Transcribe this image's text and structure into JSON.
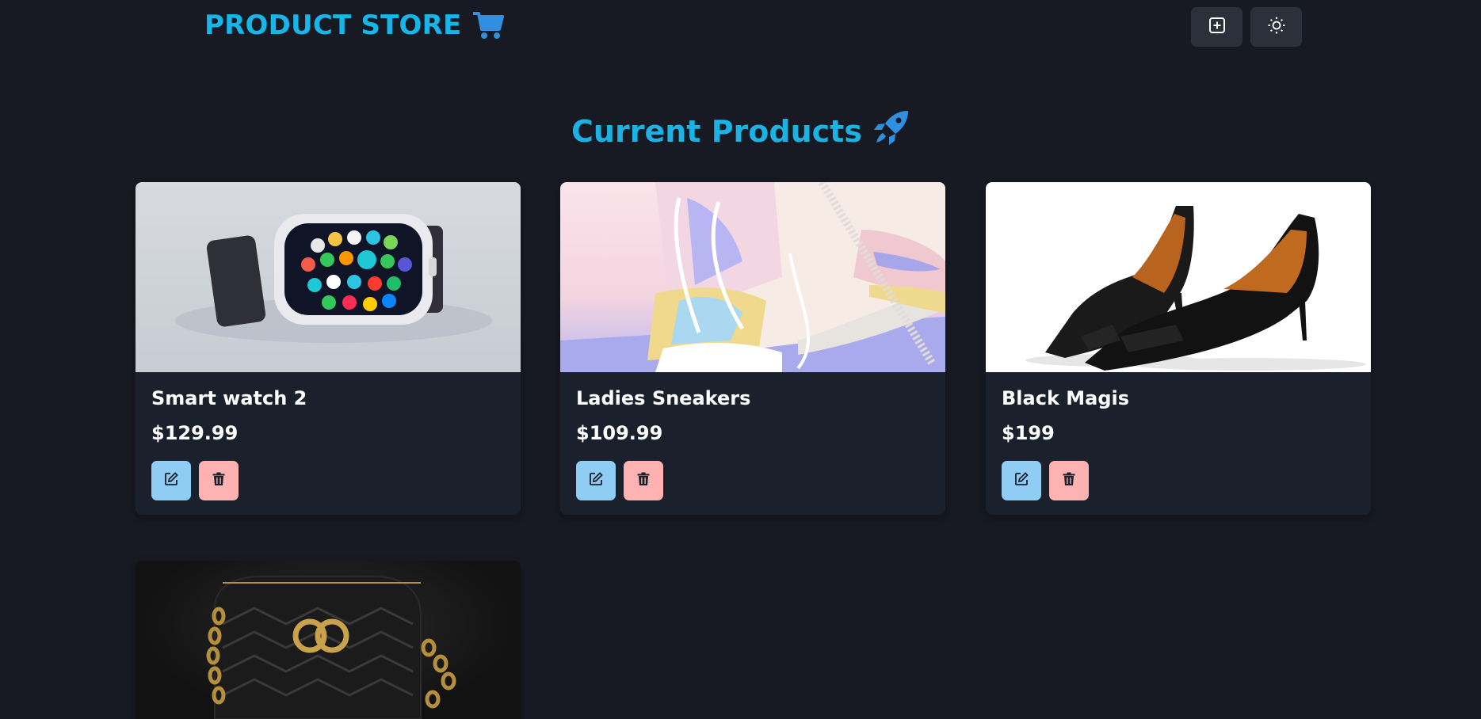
{
  "navbar": {
    "brand": "PRODUCT STORE",
    "brand_icon": "shopping-cart-icon",
    "create_button_icon": "plus-square-icon",
    "theme_button_icon": "sun-icon"
  },
  "main": {
    "heading": "Current Products",
    "heading_icon": "rocket-icon"
  },
  "products": [
    {
      "name": "Smart watch 2",
      "price": "$129.99"
    },
    {
      "name": "Ladies Sneakers",
      "price": "$109.99"
    },
    {
      "name": "Black Magis",
      "price": "$199"
    },
    {
      "name": "",
      "price": ""
    }
  ],
  "actions": {
    "edit_icon": "edit-icon",
    "delete_icon": "trash-icon"
  },
  "colors": {
    "background": "#171923",
    "brand": "#16b6e8",
    "card": "#1a202c",
    "edit_button": "#90cdf4",
    "delete_button": "#feb2b2",
    "nav_button": "#2c303a"
  }
}
